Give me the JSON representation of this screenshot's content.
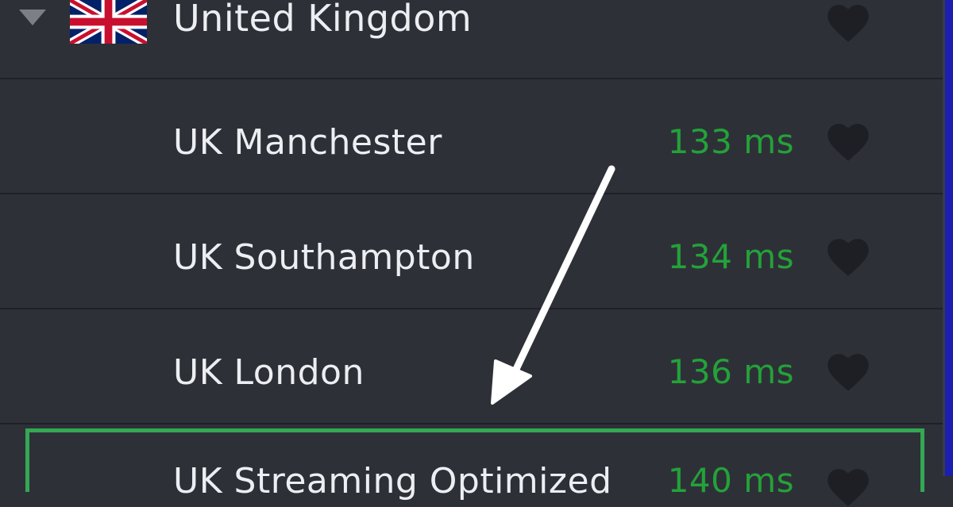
{
  "country": {
    "name": "United Kingdom",
    "flag_icon": "uk-flag-icon",
    "expanded": true
  },
  "servers": [
    {
      "name": "UK Manchester",
      "latency": "133 ms"
    },
    {
      "name": "UK Southampton",
      "latency": "134 ms"
    },
    {
      "name": "UK London",
      "latency": "136 ms"
    },
    {
      "name": "UK Streaming Optimized",
      "latency": "140 ms",
      "highlighted": true
    }
  ],
  "colors": {
    "background": "#2e3038",
    "text": "#eceef2",
    "latency": "#23a238",
    "heart": "#1e1f25",
    "highlight": "#34a853",
    "annotation_arrow": "#ffffff"
  },
  "icons": {
    "favorite": "heart-icon",
    "expand": "caret-down-icon"
  }
}
